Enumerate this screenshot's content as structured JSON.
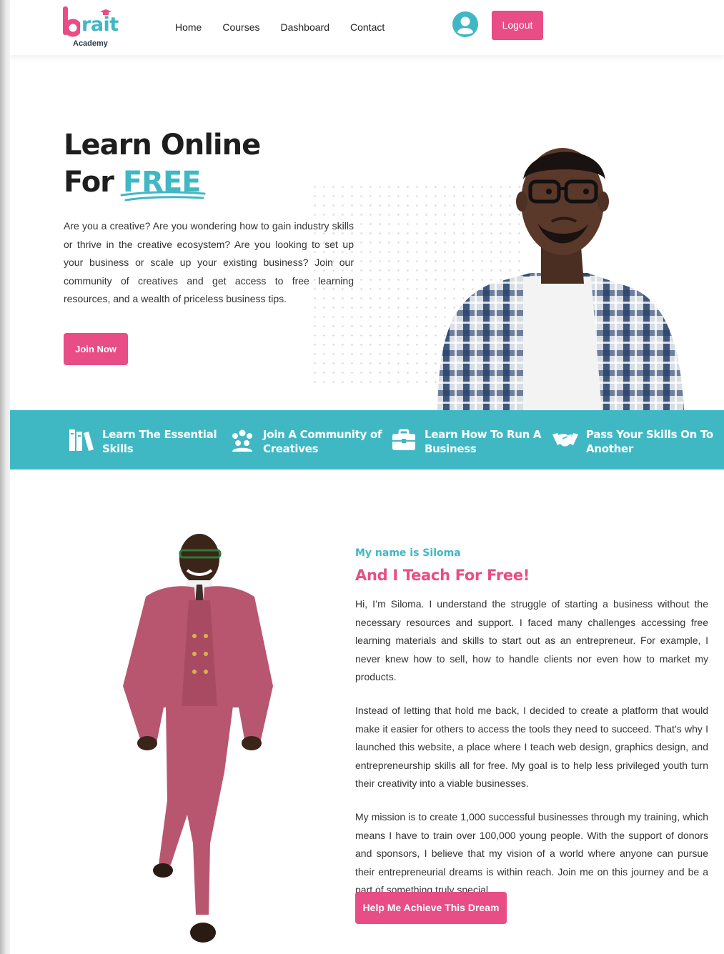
{
  "brand": {
    "logo_letter": "b",
    "logo_rest": "rait",
    "logo_subtitle": "Academy",
    "accent_teal": "#40b8c4",
    "accent_pink": "#e84d85"
  },
  "nav": {
    "items": [
      "Home",
      "Courses",
      "Dashboard",
      "Contact"
    ],
    "logout_label": "Logout",
    "avatar_icon": "user-avatar-icon"
  },
  "hero": {
    "title_line1": "Learn Online",
    "title_for": "For ",
    "title_free": "FREE",
    "description": "Are you a creative? Are you wondering how to gain industry skills or thrive in the creative ecosystem? Are you looking to set up your business or scale up your existing business? Join our community of creatives and get access to free learning resources, and a wealth of priceless business tips.",
    "join_label": "Join Now"
  },
  "features": [
    {
      "line1": "Learn The Essential",
      "line2": "Skills",
      "icon": "books-icon"
    },
    {
      "line1": "Join A Community of",
      "line2": "Creatives",
      "icon": "community-icon"
    },
    {
      "line1": "Learn How To Run A",
      "line2": "Business",
      "icon": "briefcase-icon"
    },
    {
      "line1": "Pass Your Skills On To",
      "line2": "Another",
      "icon": "handshake-icon"
    }
  ],
  "about": {
    "kicker": "My name is Siloma",
    "title": "And I Teach For Free!",
    "paragraphs": [
      "Hi, I’m Siloma. I understand the struggle of starting a business without the necessary resources and support.  I faced many challenges accessing free learning materials and skills to start out as an entrepreneur. For example, I never knew how to sell, how to handle clients nor even how to market my products.",
      "Instead of letting that hold me back, I decided to create a platform that would make it easier for others to access the tools they need to succeed. That’s why I launched this website, a place where I teach web design, graphics design, and entrepreneurship skills all for free. My goal is to help less privileged youth turn their creativity into a viable businesses.",
      "My mission is to create 1,000 successful businesses through my training, which means I have to train over 100,000 young people. With the support of donors and sponsors, I believe that my vision of a world where anyone can pursue their entrepreneurial dreams is within reach. Join me on this journey and be a part of something truly special."
    ],
    "cta_label": "Help Me Achieve This Dream"
  }
}
